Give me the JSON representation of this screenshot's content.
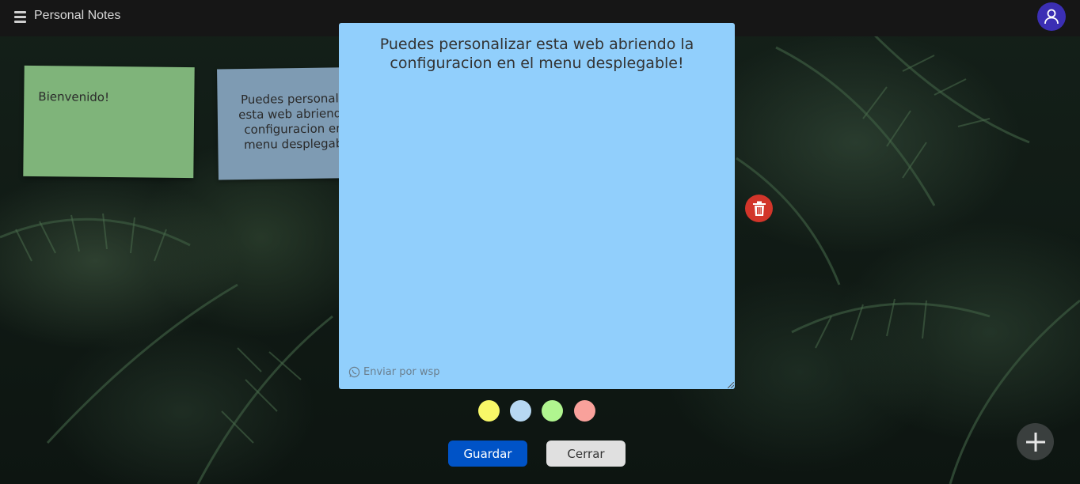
{
  "header": {
    "title": "Personal Notes",
    "menu_icon": "hamburger-menu-icon",
    "avatar_icon": "user-icon",
    "avatar_color": "#3b2fb4"
  },
  "notes": [
    {
      "text": "Bienvenido!",
      "color": "#7fb47a"
    },
    {
      "text": "Puedes personalizar esta web abriendo la configuracion en el menu desplegable!",
      "visible_text": "Puedes persona­esta web abrien­configuracion e­menu desplega",
      "color": "#7e9bb3"
    }
  ],
  "editor": {
    "text": "Puedes personalizar esta web abriendo la configuracion en el menu desplegable!",
    "background": "#91cffc",
    "share_label": "Enviar por wsp",
    "share_icon": "whatsapp-icon"
  },
  "delete": {
    "icon": "trash-icon",
    "color": "#d2352a"
  },
  "color_options": [
    "#f8f868",
    "#b7d8f2",
    "#b0f58f",
    "#f9a19b"
  ],
  "actions": {
    "save_label": "Guardar",
    "close_label": "Cerrar"
  },
  "add_button": {
    "icon": "plus-icon"
  }
}
